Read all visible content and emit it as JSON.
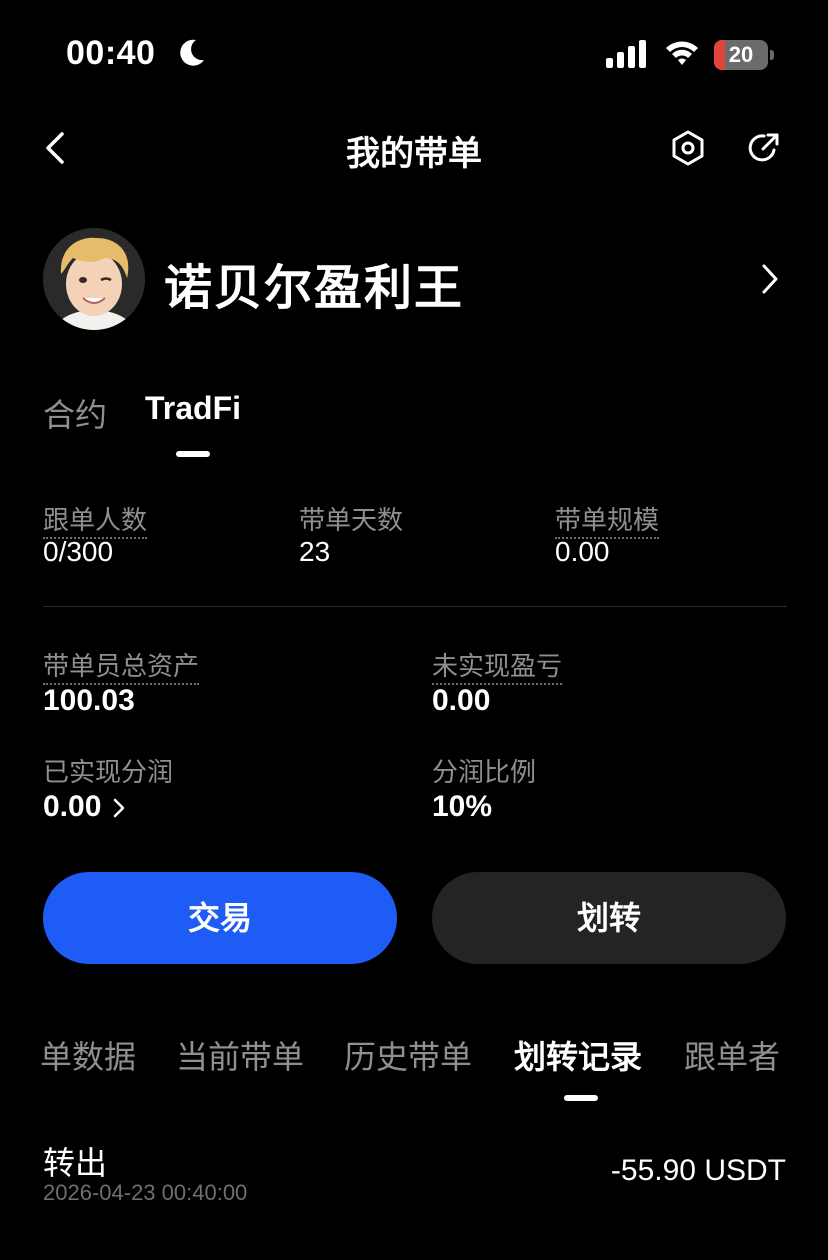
{
  "status_bar": {
    "time": "00:40",
    "battery_level": "20",
    "battery_fraction": 0.2,
    "icons": [
      "moon-icon",
      "signal-icon",
      "wifi-icon",
      "battery-icon"
    ]
  },
  "nav": {
    "title": "我的带单",
    "icons": [
      "back-icon",
      "settings-icon",
      "share-icon"
    ]
  },
  "profile": {
    "name": "诺贝尔盈利王"
  },
  "category_tabs": [
    {
      "label": "合约",
      "active": false
    },
    {
      "label": "TradFi",
      "active": true
    }
  ],
  "stats_row1": [
    {
      "label": "跟单人数",
      "value": "0/300"
    },
    {
      "label": "带单天数",
      "value": "23"
    },
    {
      "label": "带单规模",
      "value": "0.00"
    }
  ],
  "stats_row2": [
    {
      "label": "带单员总资产",
      "value": "100.03"
    },
    {
      "label": "未实现盈亏",
      "value": "0.00"
    }
  ],
  "stats_row3": [
    {
      "label": "已实现分润",
      "value": "0.00"
    },
    {
      "label": "分润比例",
      "value": "10%"
    }
  ],
  "actions": {
    "trade": "交易",
    "transfer": "划转"
  },
  "sub_tabs": [
    {
      "label": "单数据",
      "active": false
    },
    {
      "label": "当前带单",
      "active": false
    },
    {
      "label": "历史带单",
      "active": false
    },
    {
      "label": "划转记录",
      "active": true
    },
    {
      "label": "跟单者",
      "active": false
    }
  ],
  "records": [
    {
      "type": "转出",
      "time": "2026-04-23 00:40:00",
      "amount": "-55.90 USDT"
    }
  ],
  "colors": {
    "background": "#000000",
    "primary_button": "#1f5cf6",
    "secondary_button": "#242426",
    "muted_text": "#8e8e93",
    "battery_low": "#e0453d"
  }
}
